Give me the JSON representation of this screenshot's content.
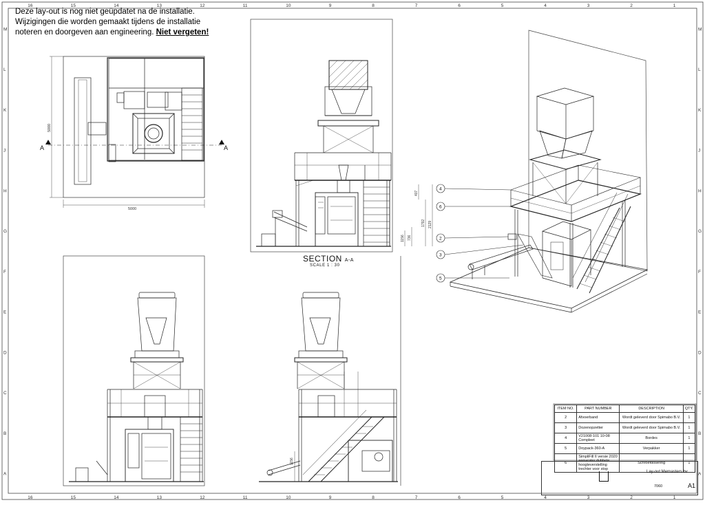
{
  "note": {
    "line1": "Deze lay-out is nog niet geüpdatet na de installatie.",
    "line2": "Wijzigingen die worden gemaakt tijdens de installatie",
    "line3_prefix": "noteren en doorgeven aan engineering. ",
    "line3_emph": "Niet vergeten!"
  },
  "grid": {
    "columns": [
      "16",
      "15",
      "14",
      "13",
      "12",
      "11",
      "10",
      "9",
      "8",
      "7",
      "6",
      "5",
      "4",
      "3",
      "2",
      "1"
    ],
    "rows": [
      "M",
      "L",
      "K",
      "J",
      "H",
      "G",
      "F",
      "E",
      "D",
      "C",
      "B",
      "A"
    ]
  },
  "plan_view": {
    "dim_width": "5000",
    "dim_height": "5000",
    "section_mark": "A"
  },
  "section": {
    "title": "SECTION",
    "title_suffix": "A-A",
    "scale": "SCALE 1 : 30",
    "dims": [
      "407",
      "1792",
      "2129",
      "736",
      "1156"
    ]
  },
  "side_view_dim": "1156",
  "balloons": [
    "4",
    "6",
    "2",
    "3",
    "5"
  ],
  "bom": {
    "headers": [
      "ITEM NO.",
      "PART NUMBER",
      "DESCRIPTION",
      "QTY."
    ],
    "rows": [
      {
        "item": "2",
        "part": "Afvoerband",
        "desc": "Wordt geleverd door Spimabo B.V.",
        "qty": "1"
      },
      {
        "item": "3",
        "part": "Dozenopzetter",
        "desc": "Wordt geleverd door Spimabo B.V.",
        "qty": "1"
      },
      {
        "item": "4",
        "part": "V21008-101 10-08 Compleet",
        "desc": "Bordes",
        "qty": "1"
      },
      {
        "item": "5",
        "part": "Doypack-360-A",
        "desc": "Verpakker",
        "qty": "1"
      },
      {
        "item": "6",
        "part": "SimpliFill II versie 2020 aanvester dubbele hoogteverstelling trechter voor stop",
        "desc": "Schroefdosering",
        "qty": "1"
      }
    ]
  },
  "title_block": {
    "title": "Lay-out Mernasters bv",
    "number": "7060",
    "size": "A1"
  }
}
